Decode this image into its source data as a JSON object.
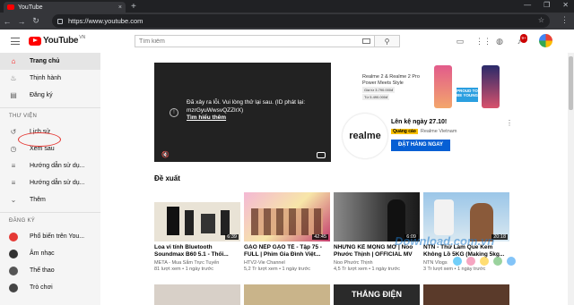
{
  "browser": {
    "tab_title": "YouTube",
    "tab_close": "×",
    "new_tab": "+",
    "url": "https://www.youtube.com",
    "window_controls": [
      "—",
      "❐",
      "✕"
    ]
  },
  "header": {
    "logo_text": "YouTube",
    "logo_region": "VN",
    "search_placeholder": "Tìm kiếm",
    "notification_count": "9+"
  },
  "sidebar": {
    "main": [
      {
        "label": "Trang chủ",
        "icon": "home-icon",
        "active": true
      },
      {
        "label": "Thịnh hành",
        "icon": "trending-icon"
      },
      {
        "label": "Đăng ký",
        "icon": "subscriptions-icon"
      }
    ],
    "library_header": "THƯ VIỆN",
    "library": [
      {
        "label": "Lịch sử",
        "icon": "history-icon"
      },
      {
        "label": "Xem sau",
        "icon": "watch-later-icon"
      },
      {
        "label": "Hướng dẫn sử dụ...",
        "icon": "playlist-icon"
      },
      {
        "label": "Hướng dẫn sử dụ...",
        "icon": "playlist-icon"
      },
      {
        "label": "Thêm",
        "icon": "chevron-down-icon"
      }
    ],
    "subs_header": "ĐĂNG KÝ",
    "subs": [
      {
        "label": "Phổ biến trên You...",
        "color": "#e53935"
      },
      {
        "label": "Âm nhạc",
        "color": "#333333"
      },
      {
        "label": "Thể thao",
        "color": "#555555"
      },
      {
        "label": "Trò chơi",
        "color": "#444444"
      }
    ]
  },
  "player": {
    "error_line1": "Đã xảy ra lỗi. Vui lòng thử lại sau. (ID phát lại:",
    "error_line2": "mzrGyuWwsvQZZlrX)",
    "learn_more": "Tìm hiểu thêm"
  },
  "ad": {
    "banner_line1": "Realme 2 & Realme 2 Pro",
    "banner_line2": "Power Meets Style",
    "banner_price1": "Giá từ 3.790.000đ",
    "banner_price2": "Từ 5.490.000đ",
    "banner_tag": "PROUD TO BE YOUNG",
    "brand": "realme",
    "title": "Lên kệ ngày 27.10!",
    "label": "Quảng cáo",
    "advertiser": "Realme Vietnam",
    "cta": "ĐẶT HÀNG NGAY",
    "more": "⋮"
  },
  "section_title": "Đề xuất",
  "videos": [
    {
      "title": "Loa vi tính Bluetooth Soundmax B60 5.1 - Thối...",
      "channel": "META - Mua Sắm Trực Tuyến",
      "meta": "81 lượt xem • 1 ngày trước",
      "duration": "6:39"
    },
    {
      "title": "GẠO NẾP GẠO TẺ - Tập 75 - FULL | Phim Gia Đình Việt...",
      "channel": "HTV2-Vie Channel",
      "meta": "5,2 Tr lượt xem • 1 ngày trước",
      "duration": "42:45"
    },
    {
      "title": "NHƯNG KẺ MỘNG MƠ | Noo Phước Thịnh | OFFICIAL MV",
      "channel": "Noo Phước Thịnh",
      "meta": "4,5 Tr lượt xem • 1 ngày trước",
      "duration": "6:09"
    },
    {
      "title": "NTN - Thử Làm Que Kem Không Lồ 5KG (Making 5kg...",
      "channel": "NTN Vlogs",
      "meta": "3 Tr lượt xem • 1 ngày trước",
      "duration": "20:18"
    }
  ],
  "row2_text": "THẮNG ĐIỆN",
  "watermark": "Download.com.vn",
  "colors": {
    "brand_red": "#ff0000",
    "link_blue": "#065fd4",
    "ad_yellow": "#f9c000"
  }
}
